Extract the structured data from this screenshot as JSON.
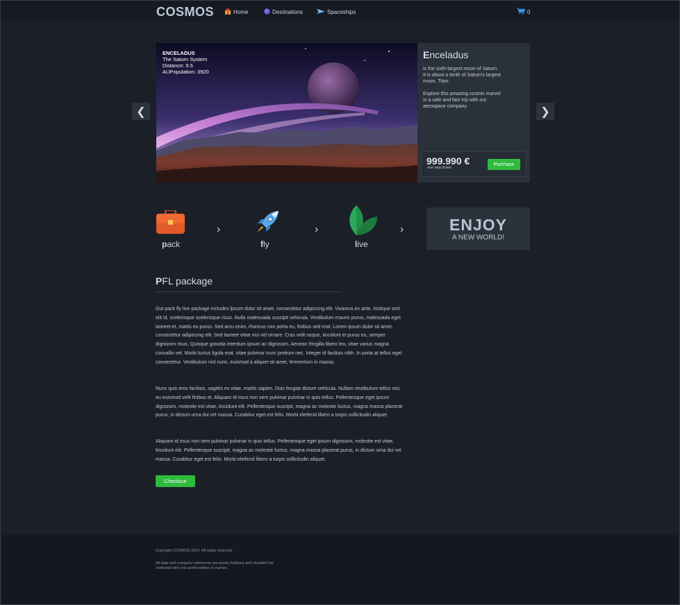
{
  "nav": {
    "logo": "COSMOS",
    "links": [
      {
        "label": "Home",
        "icon": "house-icon"
      },
      {
        "label": "Destinations",
        "icon": "planet-icon"
      },
      {
        "label": "Spaceships",
        "icon": "spaceship-icon"
      }
    ],
    "cart_count": "0"
  },
  "slider": {
    "prev": "❮",
    "next": "❯",
    "overlay": {
      "name": "ENCELADUS",
      "system": "The Saturn System",
      "distance": "Distance: 9.5",
      "population": "AUPopulation: 3920"
    },
    "title_first": "E",
    "title_rest": "nceladus",
    "desc1": "is the sixth-largest moon of Saturn. It is about a tenth of Saturn's largest moon, Titan.",
    "desc2": "Explore this amazing cosmic marvel in a safe and fast trip with our aerospace company.",
    "price": "999.990 €",
    "price_sub": "one way ticket",
    "purchase": "Purchase"
  },
  "steps": {
    "items": [
      {
        "first": "p",
        "rest": "ack",
        "icon": "briefcase-icon"
      },
      {
        "first": "f",
        "rest": "ly",
        "icon": "rocket-icon"
      },
      {
        "first": "l",
        "rest": "ive",
        "icon": "leaf-icon"
      }
    ],
    "chevron": "›",
    "enjoy": "ENJOY",
    "enjoy_sub": "A NEW WORLD!"
  },
  "package": {
    "title_first": "P",
    "title_rest": "FL package",
    "para1": "Out pack fly live package includes lpsum dolor sit amet, consectetur adipiscing elit. Vivamus ex ante, tristique sed elit id, scelerisque scelerisque risus. Nulla malesuada suscipit vehicula. Vestibulum mauris purus, malesuada eget laoreet et, mattis eu purus. Sed arcu enim, rhoncus non porta eu, finibus sed erat. Lorem ipsum dolor sit amet, consectetur adipiscing elit. Sed laoreet vitae nisi vel ornare. Cras velit neque, tincidunt et purus eu, semper dignissim risus. Quisque gravida interdum ipsum ac dignissim. Aenean fringilla libero leo, vitae varius magna convallis vel. Morbi luctus ligula erat, vitae pulvinar nunc pretium nec. Integer id facilisis nibh. In porta at tellus eget consectetur. Vestibulum nisl nunc, euismod a aliquet sit amet, fermentum in massa.",
    "para2": "Nunc quis eros facilisis, sagittis ex vitae, mattis sapien. Duis feugiat dictum vehicula. Nullam vestibulum tellus nisi, eu euismod velit finibus et. Aliquam id risus non sem pulvinar pulvinar in quis tellus. Pellentesque eget ipsum dignissim, molestie est vitae, tincidunt elit. Pellentesque suscipit, magna ac molestie luctus, magna massa placerat purus, in dictum urna dui vel massa. Curabitur eget est felis. Morbi eleifend libero a turpis sollicitudin aliquet.",
    "para3": "Aliquam id risus non sem pulvinar pulvinar in quis tellus. Pellentesque eget ipsum dignissim, molestie est vitae, tincidunt elit. Pellentesque suscipit, magna ac molestie luctus, magna massa placerat purus, in dictum urna dui vel massa. Curabitur eget est felis. Morbi eleifend libero a turpis sollicitudin aliquet.",
    "checkout": "Checkout"
  },
  "footer": {
    "copyright": "Copyright COSMOS 2022. All rights reserved.",
    "note": "All data and company references are purely fictitious and shouldn't be confused with real world entities or names."
  },
  "colors": {
    "accent_green": "#2fbb3e",
    "background": "#1b2028",
    "nav": "#161b22"
  }
}
